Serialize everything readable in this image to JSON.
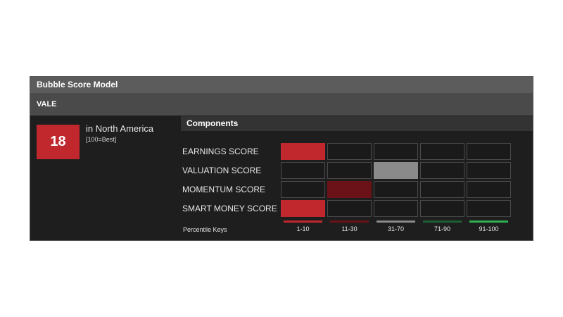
{
  "widget": {
    "title": "Bubble Score Model",
    "ticker": "VALE",
    "score": "18",
    "region": "in North America",
    "scale_note": "[100=Best]",
    "components_title": "Components"
  },
  "rows": [
    {
      "label": "EARNINGS SCORE",
      "active_index": 0
    },
    {
      "label": "VALUATION SCORE",
      "active_index": 2
    },
    {
      "label": "MOMENTUM SCORE",
      "active_index": 1
    },
    {
      "label": "SMART MONEY SCORE",
      "active_index": 0
    }
  ],
  "percentile_keys": {
    "label": "Percentile Keys",
    "items": [
      {
        "range": "1-10",
        "color": "#c0282e"
      },
      {
        "range": "11-30",
        "color": "#6a1218"
      },
      {
        "range": "31-70",
        "color": "#8a8a8a"
      },
      {
        "range": "71-90",
        "color": "#1e5e34"
      },
      {
        "range": "91-100",
        "color": "#2fae52"
      }
    ]
  },
  "colors": {
    "score_box": "#c0282e",
    "cell_empty": "#1a1a1a"
  }
}
